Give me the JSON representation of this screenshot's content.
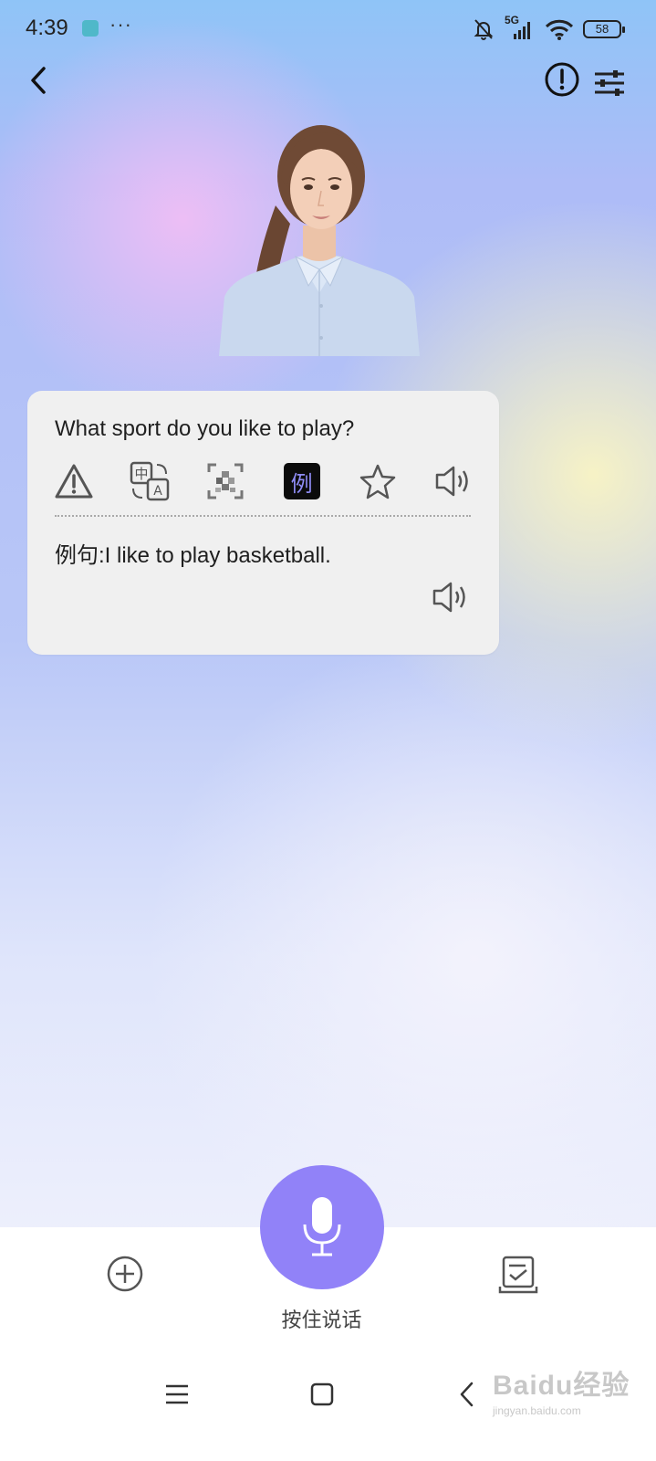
{
  "status_bar": {
    "time": "4:39",
    "more": "···",
    "network": "5G",
    "battery": "58"
  },
  "toolbar": {
    "back_icon": "chevron-left-icon",
    "info_icon": "exclamation-circle-icon",
    "settings_icon": "sliders-icon"
  },
  "card": {
    "question": "What sport do you like to play?",
    "actions": [
      {
        "name": "report",
        "icon": "warning-triangle-icon"
      },
      {
        "name": "translate",
        "icon": "translate-icon"
      },
      {
        "name": "mosaic",
        "icon": "mosaic-icon"
      },
      {
        "name": "example",
        "label": "例"
      },
      {
        "name": "favorite",
        "icon": "star-icon"
      },
      {
        "name": "speak",
        "icon": "speaker-icon"
      }
    ],
    "example": "例句:I like to play basketball."
  },
  "bottom_bar": {
    "add_icon": "plus-circle-icon",
    "mic_label": "按住说话",
    "notes_icon": "checklist-icon"
  },
  "watermark": {
    "brand": "Baidu经验",
    "domain": "jingyan.baidu.com"
  },
  "colors": {
    "accent": "#9182f8",
    "example_text": "#8f8cf5",
    "card_bg": "#f0f0f0"
  }
}
